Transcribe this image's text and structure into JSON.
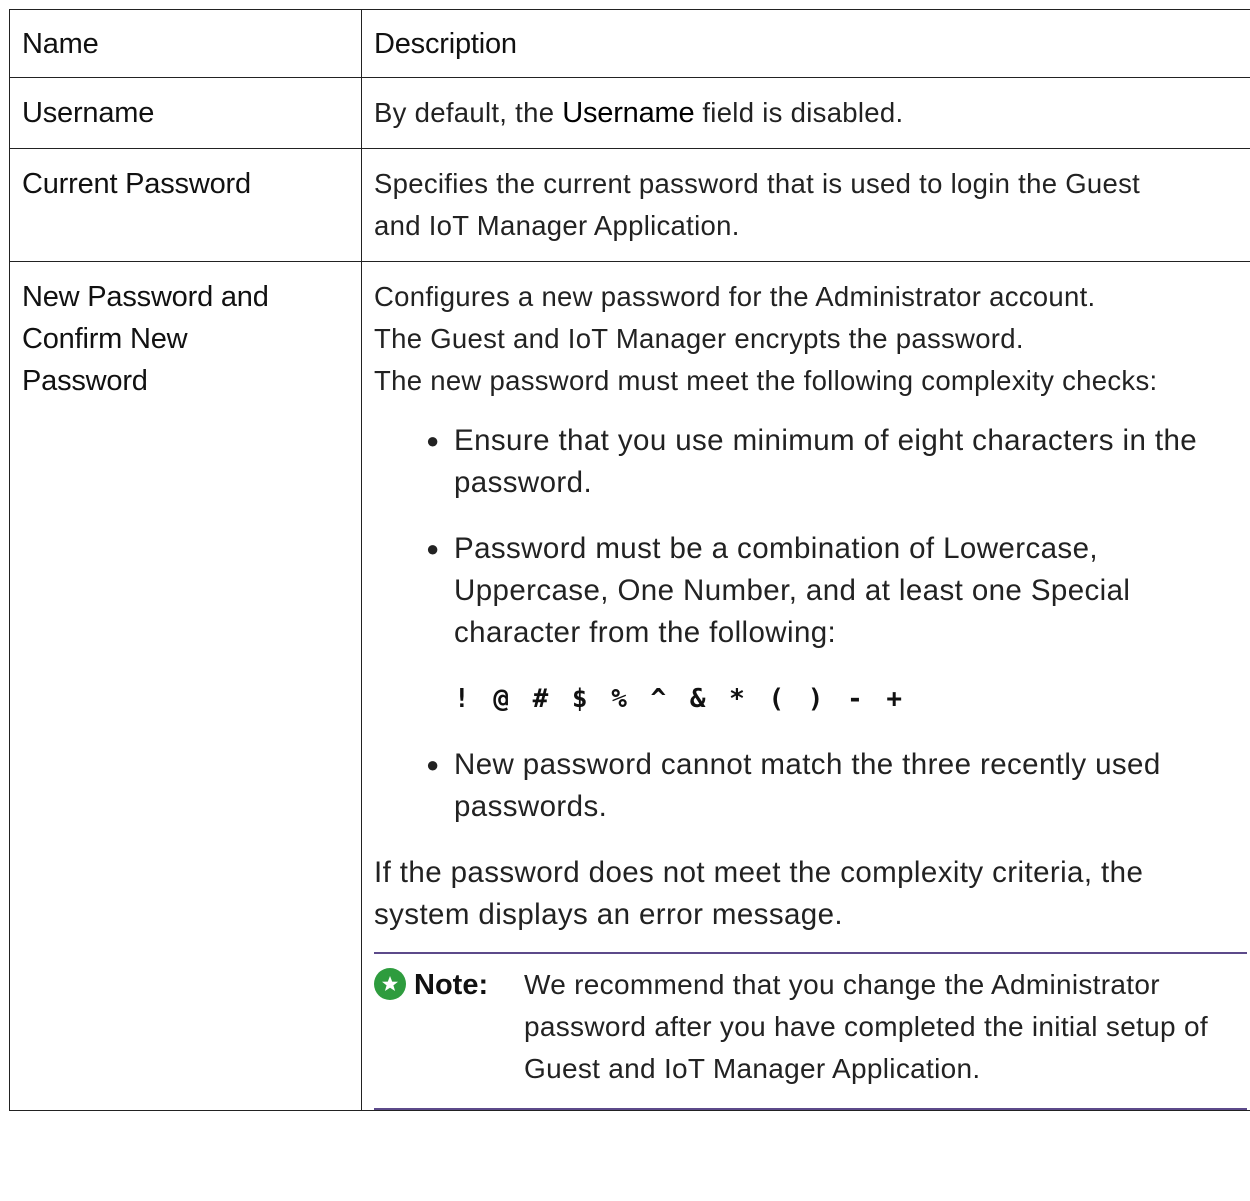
{
  "headers": {
    "name": "Name",
    "description": "Description"
  },
  "rows": [
    {
      "name": "Username",
      "desc_before": "By default, the ",
      "desc_bold": "Username",
      "desc_after": " field is disabled."
    },
    {
      "name": "Current Password",
      "desc": "Specifies the current password that is used to login the Guest and IoT Manager Application."
    },
    {
      "name": "New Password and Confirm New Password",
      "intro_lines": [
        "Configures a new password for the Administrator account.",
        "The Guest and IoT Manager encrypts the password.",
        "The new password must meet the following complexity checks:"
      ],
      "checks": [
        "Ensure that you use minimum of eight characters in the password.",
        "Password must be a combination of Lowercase, Uppercase, One Number, and at least one Special character from the following:",
        "New password cannot match the three recently used passwords."
      ],
      "special_chars": "! @ # $ % ^ & * ( ) - +",
      "criteria": "If the password does not meet the complexity criteria, the system displays an error message.",
      "note_label": "Note:",
      "note_text": "We recommend that you change the Administrator password after you have completed the initial setup of Guest and IoT Manager Application."
    }
  ],
  "colors": {
    "note_icon": "#2e9c3e",
    "note_rule": "#5c4a8a"
  }
}
